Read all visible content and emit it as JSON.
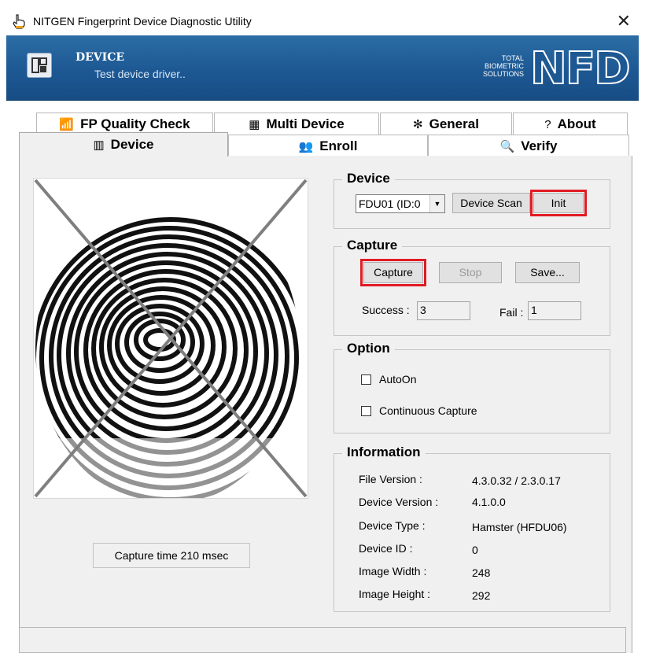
{
  "window": {
    "title": "NITGEN Fingerprint Device Diagnostic Utility",
    "close_glyph": "✕"
  },
  "banner": {
    "title": "DEVICE",
    "subtitle": "Test device driver..",
    "brand_line1": "TOTAL",
    "brand_line2": "BIOMETRIC",
    "brand_line3": "SOLUTIONS",
    "brand_logo": "NFD"
  },
  "tabs": {
    "fp_quality": "FP Quality Check",
    "multi_device": "Multi Device",
    "general": "General",
    "about": "About",
    "device": "Device",
    "enroll": "Enroll",
    "verify": "Verify"
  },
  "device_group": {
    "legend": "Device",
    "combo_value": "FDU01 (ID:0",
    "scan_button": "Device Scan",
    "init_button": "Init"
  },
  "capture_group": {
    "legend": "Capture",
    "capture_button": "Capture",
    "stop_button": "Stop",
    "save_button": "Save...",
    "success_label": "Success :",
    "success_value": "3",
    "fail_label": "Fail :",
    "fail_value": "1"
  },
  "option_group": {
    "legend": "Option",
    "autoon_label": "AutoOn",
    "continuous_label": "Continuous Capture"
  },
  "info_group": {
    "legend": "Information",
    "rows": [
      {
        "label": "File Version :",
        "value": "4.3.0.32 / 2.3.0.17"
      },
      {
        "label": "Device Version :",
        "value": "4.1.0.0"
      },
      {
        "label": "Device Type :",
        "value": "Hamster (HFDU06)"
      },
      {
        "label": "Device ID :",
        "value": "0"
      },
      {
        "label": "Image Width :",
        "value": "248"
      },
      {
        "label": "Image Height :",
        "value": "292"
      }
    ]
  },
  "capture_time": "Capture time 210 msec",
  "colors": {
    "banner": "#1d5893",
    "highlight": "#e11b24",
    "panel": "#f0f0f0"
  }
}
